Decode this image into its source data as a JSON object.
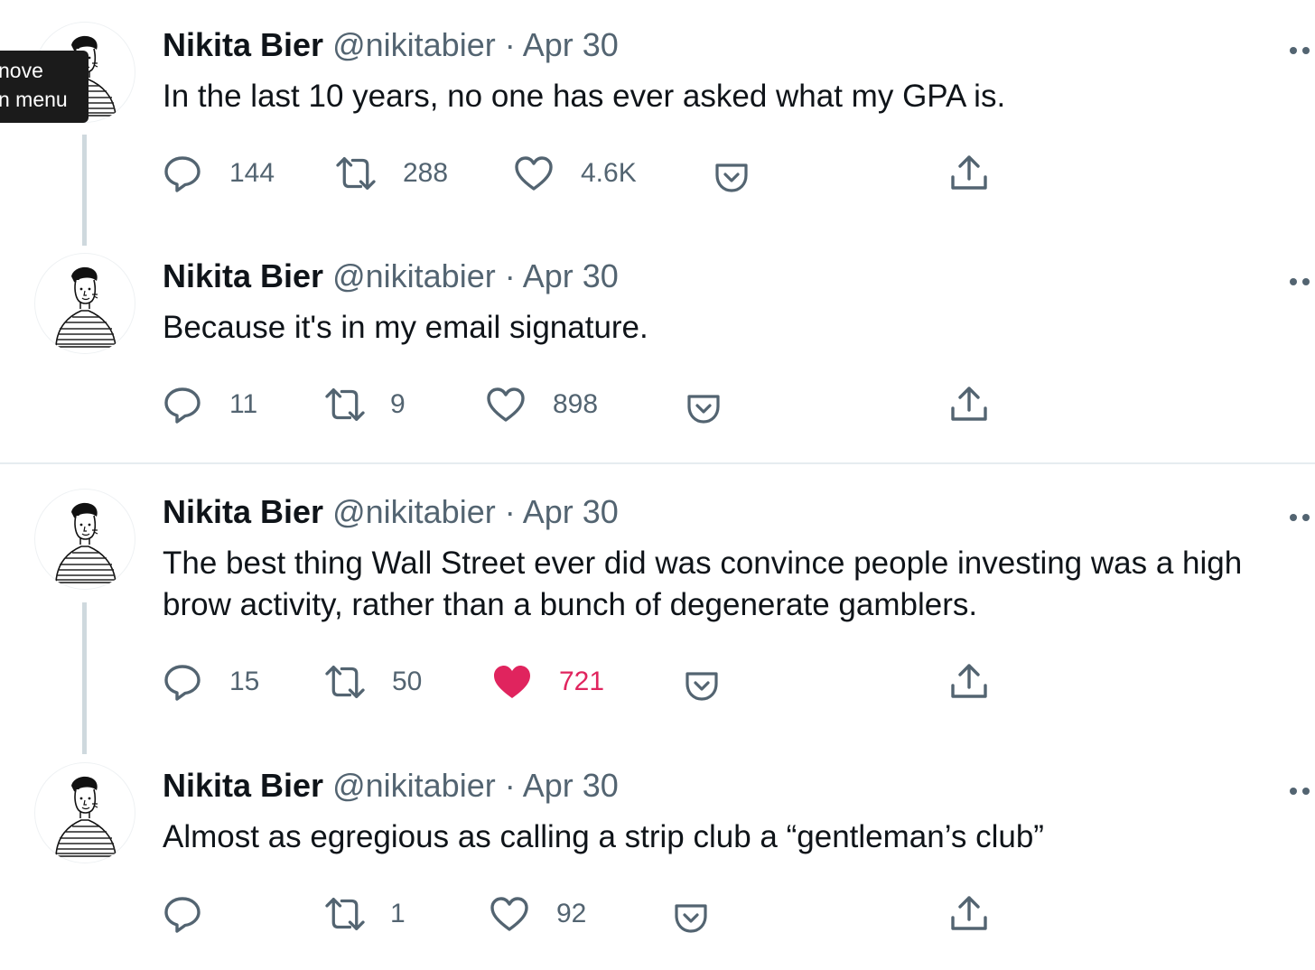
{
  "tooltip": {
    "line1": "nove",
    "line2": "n menu"
  },
  "colors": {
    "text": "#0f1419",
    "secondary": "#536471",
    "like_active": "#e0245e",
    "thread_line": "#cfd9de"
  },
  "tweets": [
    {
      "name": "Nikita Bier",
      "handle": "@nikitabier",
      "separator": "·",
      "date": "Apr 30",
      "text": "In the last 10 years, no one has ever asked what my GPA is.",
      "replies": "144",
      "retweets": "288",
      "likes": "4.6K",
      "liked": false
    },
    {
      "name": "Nikita Bier",
      "handle": "@nikitabier",
      "separator": "·",
      "date": "Apr 30",
      "text": "Because it's in my email signature.",
      "replies": "11",
      "retweets": "9",
      "likes": "898",
      "liked": false
    },
    {
      "name": "Nikita Bier",
      "handle": "@nikitabier",
      "separator": "·",
      "date": "Apr 30",
      "text": "The best thing Wall Street ever did was convince people investing was a high brow activity, rather than a bunch of degenerate gamblers.",
      "replies": "15",
      "retweets": "50",
      "likes": "721",
      "liked": true
    },
    {
      "name": "Nikita Bier",
      "handle": "@nikitabier",
      "separator": "·",
      "date": "Apr 30",
      "text": "Almost as egregious as calling a strip club a “gentleman’s club”",
      "replies": "",
      "retweets": "1",
      "likes": "92",
      "liked": false
    }
  ],
  "icons": {
    "reply": "speech-bubble-icon",
    "retweet": "retweet-arrows-icon",
    "like": "heart-icon",
    "save": "pocket-save-icon",
    "share": "share-upload-icon",
    "more": "more-dots-icon"
  }
}
